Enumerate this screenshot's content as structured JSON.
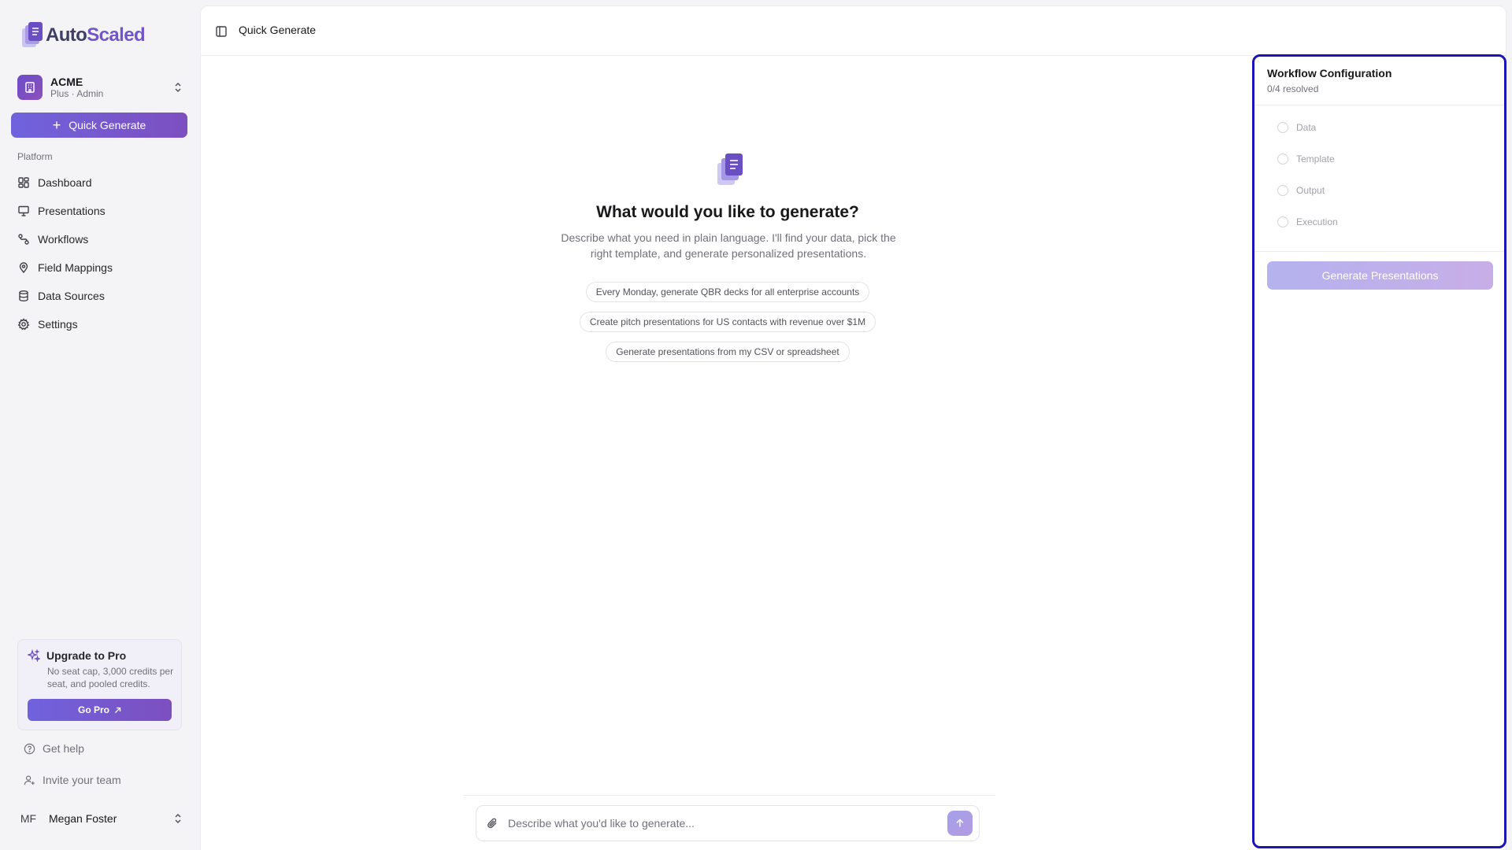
{
  "brand": {
    "part1": "Auto",
    "part2": "Scaled"
  },
  "org": {
    "name": "ACME",
    "plan": "Plus · Admin"
  },
  "sidebar": {
    "quick_generate_label": "Quick Generate",
    "section_label": "Platform",
    "items": [
      {
        "label": "Dashboard",
        "icon": "dashboard-icon"
      },
      {
        "label": "Presentations",
        "icon": "presentation-icon"
      },
      {
        "label": "Workflows",
        "icon": "workflow-icon"
      },
      {
        "label": "Field Mappings",
        "icon": "map-pin-icon"
      },
      {
        "label": "Data Sources",
        "icon": "database-icon"
      },
      {
        "label": "Settings",
        "icon": "gear-icon"
      }
    ],
    "upgrade": {
      "title": "Upgrade to Pro",
      "description": "No seat cap, 3,000 credits per seat, and pooled credits.",
      "button_label": "Go Pro"
    },
    "help_label": "Get help",
    "invite_label": "Invite your team",
    "user": {
      "initials": "MF",
      "name": "Megan Foster"
    }
  },
  "header": {
    "title": "Quick Generate"
  },
  "hero": {
    "title": "What would you like to generate?",
    "description": "Describe what you need in plain language. I'll find your data, pick the right template, and generate personalized presentations.",
    "suggestions": [
      "Every Monday, generate QBR decks for all enterprise accounts",
      "Create pitch presentations for US contacts with revenue over $1M",
      "Generate presentations from my CSV or spreadsheet"
    ]
  },
  "composer": {
    "placeholder": "Describe what you'd like to generate..."
  },
  "workflow": {
    "title": "Workflow Configuration",
    "status": "0/4 resolved",
    "steps": [
      "Data",
      "Template",
      "Output",
      "Execution"
    ],
    "generate_label": "Generate Presentations"
  },
  "colors": {
    "accent": "#7256c9",
    "panel_border": "#1d14b5"
  }
}
